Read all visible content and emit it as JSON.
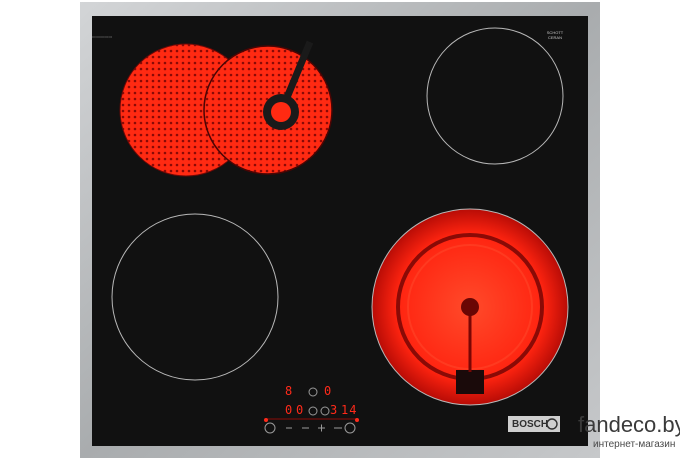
{
  "product": {
    "brand_label": "BOSCH",
    "glass_label": "SCHOTT CERAN",
    "glass_label_lines": [
      "SCHOTT",
      "CERAN"
    ]
  },
  "control_panel": {
    "top_display_left": "8",
    "top_display_mid": "0",
    "bottom_display_left": "0",
    "bottom_display_mid": "0",
    "bottom_display_right": "3",
    "bottom_display_far": "14"
  },
  "watermark": {
    "main": "fandeco.by",
    "sub": "интернет-магазин"
  },
  "colors": {
    "glass": "#111111",
    "frame": "#b8bbbd",
    "heat": "#ff2a12",
    "zone_outline": "#b8b8b8"
  }
}
